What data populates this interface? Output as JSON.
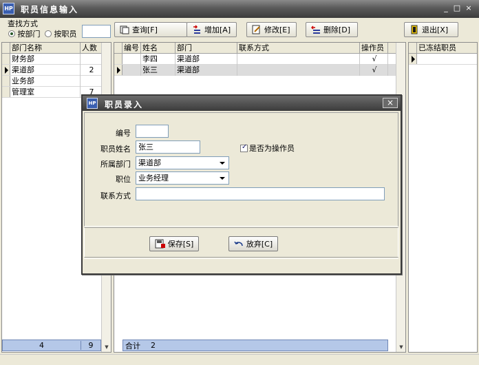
{
  "window": {
    "title": "职员信息输入",
    "icon_text": "HP"
  },
  "search": {
    "label": "查找方式",
    "option_dept": "按部门",
    "option_staff": "按职员",
    "selected": "dept",
    "value": ""
  },
  "toolbar": {
    "query_label": "查询[F]",
    "add_label": "增加[A]",
    "edit_label": "修改[E]",
    "delete_label": "删除[D]",
    "exit_label": "退出[X]"
  },
  "dept_grid": {
    "columns": [
      "部门名称",
      "人数"
    ],
    "rows": [
      {
        "name": "财务部",
        "count": ""
      },
      {
        "name": "渠道部",
        "count": "2"
      },
      {
        "name": "业务部",
        "count": ""
      },
      {
        "name": "管理室",
        "count": "7"
      }
    ],
    "current_row": 1,
    "footer_total": "4",
    "footer_count": "9"
  },
  "staff_grid": {
    "columns": [
      "编号",
      "姓名",
      "部门",
      "联系方式",
      "操作员"
    ],
    "rows": [
      {
        "id": "",
        "name": "李四",
        "dept": "渠道部",
        "contact": "",
        "operator": "√"
      },
      {
        "id": "",
        "name": "张三",
        "dept": "渠道部",
        "contact": "",
        "operator": "√"
      }
    ],
    "current_row": 1,
    "footer_label": "合计",
    "footer_count": "2"
  },
  "settled_grid": {
    "columns": [
      "已冻结职员"
    ]
  },
  "dialog": {
    "title": "职员录入",
    "close_glyph": "×",
    "fields": {
      "id_label": "编号",
      "id_value": "",
      "name_label": "职员姓名",
      "name_value": "张三",
      "dept_label": "所属部门",
      "dept_value": "渠道部",
      "position_label": "职位",
      "position_value": "业务经理",
      "contact_label": "联系方式",
      "contact_value": ""
    },
    "operator_checkbox_label": "是否为操作员",
    "operator_checked": true,
    "save_label": "保存[S]",
    "cancel_label": "放弃[C]"
  }
}
